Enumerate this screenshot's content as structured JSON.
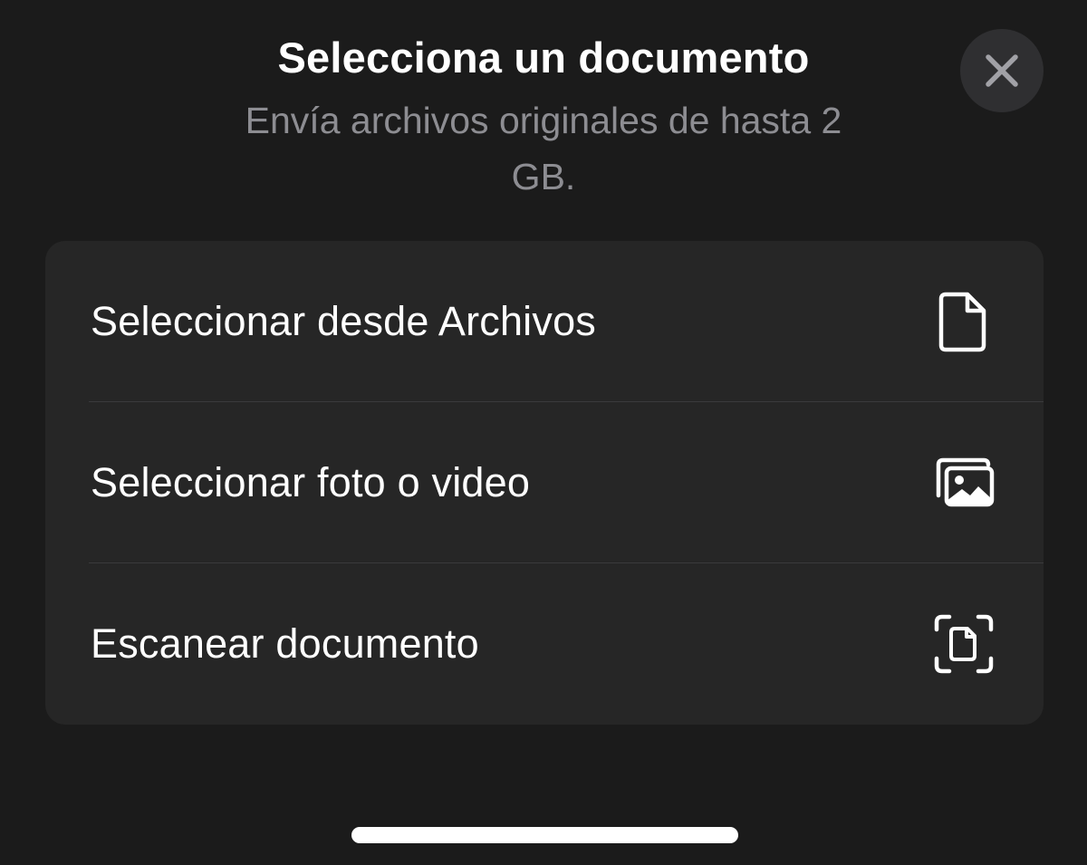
{
  "header": {
    "title": "Selecciona un documento",
    "subtitle": "Envía archivos originales de hasta 2 GB."
  },
  "close_button": {
    "icon": "close-icon"
  },
  "options": [
    {
      "label": "Seleccionar desde Archivos",
      "icon": "file-icon"
    },
    {
      "label": "Seleccionar foto o video",
      "icon": "photos-icon"
    },
    {
      "label": "Escanear documento",
      "icon": "scan-document-icon"
    }
  ],
  "colors": {
    "background": "#1b1b1b",
    "card": "#262626",
    "text": "#ffffff",
    "secondary_text": "#8d8d92",
    "close_button_bg": "#2f2f31"
  }
}
